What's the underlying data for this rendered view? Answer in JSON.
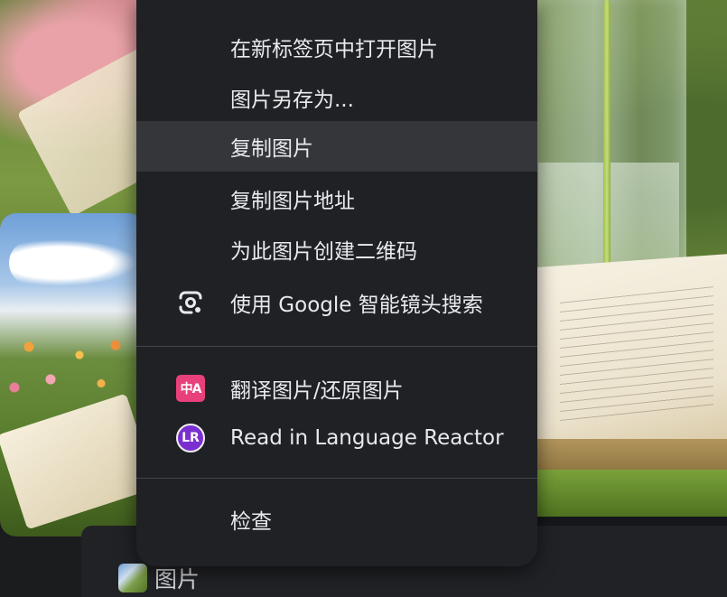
{
  "context_menu": {
    "items": [
      {
        "label": "在新标签页中打开图片",
        "icon": null,
        "highlighted": false
      },
      {
        "label": "图片另存为...",
        "icon": null,
        "highlighted": false
      },
      {
        "label": "复制图片",
        "icon": null,
        "highlighted": true
      },
      {
        "label": "复制图片地址",
        "icon": null,
        "highlighted": false
      },
      {
        "label": "为此图片创建二维码",
        "icon": null,
        "highlighted": false
      },
      {
        "label": "使用 Google 智能镜头搜索",
        "icon": "google-lens-icon",
        "highlighted": false
      },
      {
        "label": "翻译图片/还原图片",
        "icon": "translate-image-icon",
        "icon_text": "中A",
        "icon_color": "#e8407a",
        "highlighted": false
      },
      {
        "label": "Read in Language Reactor",
        "icon": "language-reactor-icon",
        "icon_text": "LR",
        "icon_color": "#7a2fd0",
        "highlighted": false
      },
      {
        "label": "检查",
        "icon": null,
        "highlighted": false
      }
    ]
  },
  "bottom_tab": {
    "label": "图片",
    "icon": "image-thumbnail-icon"
  },
  "colors": {
    "menu_background": "#202124",
    "menu_highlight": "#35363a",
    "menu_text": "#e8eaed",
    "divider": "#45464a"
  }
}
